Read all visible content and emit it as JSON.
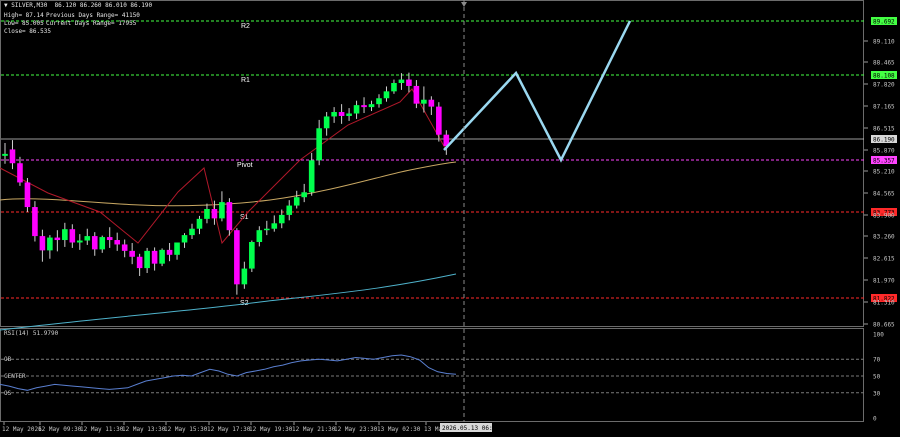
{
  "header": {
    "symbol_line": "▼ SILVER,M30  86.120 86.260 86.010 86.190",
    "high": "High= 87.14",
    "prev_range": "Previous Days Range= 41150",
    "low": "Low= 85.005",
    "cur_range": "Current Days Range= 17955",
    "close": "Close= 86.535"
  },
  "colors": {
    "background": "#000000",
    "bull_candle": "#00ff4c",
    "bear_candle": "#ff00ff",
    "resistance": "#44ff44",
    "support": "#ff2a2a",
    "pivot": "#ff44ff",
    "projection": "#9ad8f0",
    "rsi_line": "#5a7fd0"
  },
  "levels": {
    "R2": {
      "label": "R2",
      "price": "89.692",
      "color": "#44ff44"
    },
    "R1": {
      "label": "R1",
      "price": "88.108",
      "color": "#44ff44"
    },
    "current": {
      "price": "86.190",
      "color": "#d0d0d0"
    },
    "Pivot": {
      "label": "Pivot",
      "price": "85.357",
      "color": "#ff44ff"
    },
    "S1": {
      "label": "S1",
      "price": "83.773",
      "color": "#ff2a2a"
    },
    "S2": {
      "label": "S2",
      "price": "81.822",
      "color": "#ff2a2a"
    }
  },
  "price_axis": [
    "89.110",
    "88.465",
    "87.820",
    "87.165",
    "86.515",
    "85.870",
    "85.210",
    "84.565",
    "83.900",
    "83.260",
    "82.615",
    "81.970",
    "81.310",
    "80.665"
  ],
  "rsi": {
    "title": "RSI(14) 51.9790",
    "ob": "OB",
    "center": "CENTER",
    "os": "OS",
    "axis": [
      "100",
      "70",
      "50",
      "30",
      "0"
    ]
  },
  "time_axis": [
    "12 May 2026",
    "12 May 09:30",
    "12 May 11:30",
    "12 May 13:30",
    "12 May 15:30",
    "12 May 17:30",
    "12 May 19:30",
    "12 May 21:30",
    "12 May 23:30",
    "13 May 02:30",
    "13 Ma"
  ],
  "crosshair_time": "2026.05.13 06:30",
  "candles": [
    [
      85.99,
      86.25,
      86.03,
      85.83
    ],
    [
      86.12,
      86.31,
      85.84,
      85.72
    ],
    [
      85.84,
      85.97,
      85.45,
      85.38
    ],
    [
      85.45,
      85.54,
      84.95,
      84.85
    ],
    [
      84.95,
      85.07,
      84.36,
      84.25
    ],
    [
      84.36,
      84.49,
      84.07,
      83.84
    ],
    [
      84.07,
      84.38,
      84.33,
      83.9
    ],
    [
      84.33,
      84.48,
      84.28,
      84.05
    ],
    [
      84.28,
      84.63,
      84.5,
      84.14
    ],
    [
      84.5,
      84.6,
      84.23,
      84.12
    ],
    [
      84.23,
      84.4,
      84.27,
      84.08
    ],
    [
      84.27,
      84.51,
      84.36,
      84.18
    ],
    [
      84.36,
      84.44,
      84.09,
      83.96
    ],
    [
      84.09,
      84.37,
      84.34,
      84.02
    ],
    [
      84.34,
      84.54,
      84.28,
      84.12
    ],
    [
      84.28,
      84.43,
      84.19,
      84.06
    ],
    [
      84.19,
      84.29,
      84.06,
      83.93
    ],
    [
      84.06,
      84.22,
      83.94,
      83.79
    ],
    [
      83.94,
      84.0,
      83.71,
      83.55
    ],
    [
      83.71,
      84.12,
      84.06,
      83.61
    ],
    [
      84.06,
      84.13,
      83.8,
      83.66
    ],
    [
      83.8,
      84.11,
      84.08,
      83.75
    ],
    [
      84.08,
      84.22,
      83.98,
      83.85
    ],
    [
      83.98,
      84.23,
      84.23,
      83.88
    ],
    [
      84.23,
      84.42,
      84.38,
      84.12
    ],
    [
      84.38,
      84.61,
      84.51,
      84.3
    ],
    [
      84.51,
      84.77,
      84.71,
      84.4
    ],
    [
      84.71,
      85.02,
      84.91,
      84.62
    ],
    [
      84.91,
      85.08,
      84.72,
      84.59
    ],
    [
      84.72,
      85.27,
      85.05,
      84.66
    ],
    [
      85.05,
      85.13,
      84.48,
      84.37
    ],
    [
      84.48,
      84.52,
      83.38,
      83.17
    ],
    [
      83.38,
      83.84,
      83.7,
      83.29
    ],
    [
      83.7,
      84.27,
      84.24,
      83.63
    ],
    [
      84.24,
      84.56,
      84.48,
      84.15
    ],
    [
      84.48,
      84.67,
      84.51,
      84.38
    ],
    [
      84.51,
      84.78,
      84.62,
      84.45
    ],
    [
      84.62,
      84.9,
      84.79,
      84.52
    ],
    [
      84.79,
      85.09,
      84.98,
      84.68
    ],
    [
      84.98,
      85.28,
      85.15,
      84.92
    ],
    [
      85.15,
      85.42,
      85.25,
      85.05
    ],
    [
      85.25,
      86.05,
      85.9,
      85.18
    ],
    [
      85.9,
      86.72,
      86.55,
      85.8
    ],
    [
      86.55,
      86.88,
      86.79,
      86.4
    ],
    [
      86.79,
      86.98,
      86.88,
      86.66
    ],
    [
      86.88,
      87.04,
      86.8,
      86.64
    ],
    [
      86.8,
      86.96,
      86.85,
      86.7
    ],
    [
      86.85,
      87.11,
      87.02,
      86.74
    ],
    [
      87.02,
      87.18,
      86.98,
      86.86
    ],
    [
      86.98,
      87.11,
      87.04,
      86.9
    ],
    [
      87.04,
      87.24,
      87.16,
      86.97
    ],
    [
      87.16,
      87.4,
      87.3,
      87.09
    ],
    [
      87.3,
      87.54,
      87.47,
      87.25
    ],
    [
      87.47,
      87.67,
      87.54,
      87.33
    ],
    [
      87.54,
      87.68,
      87.41,
      87.28
    ],
    [
      87.41,
      87.53,
      87.05,
      86.96
    ],
    [
      87.05,
      87.4,
      87.13,
      86.87
    ],
    [
      87.13,
      87.2,
      86.99,
      86.82
    ],
    [
      86.99,
      87.08,
      86.42,
      86.28
    ],
    [
      86.42,
      86.51,
      86.19,
      86.01
    ]
  ],
  "rsi_values": [
    40,
    38,
    35,
    33,
    36,
    38,
    40,
    39,
    38,
    37,
    36,
    35,
    34,
    35,
    36,
    40,
    44,
    46,
    48,
    50,
    51,
    50,
    54,
    58,
    56,
    52,
    50,
    54,
    56,
    58,
    61,
    63,
    66,
    68,
    69,
    70,
    69,
    68,
    70,
    72,
    71,
    70,
    72,
    74,
    75,
    73,
    69,
    60,
    55,
    53,
    52
  ]
}
